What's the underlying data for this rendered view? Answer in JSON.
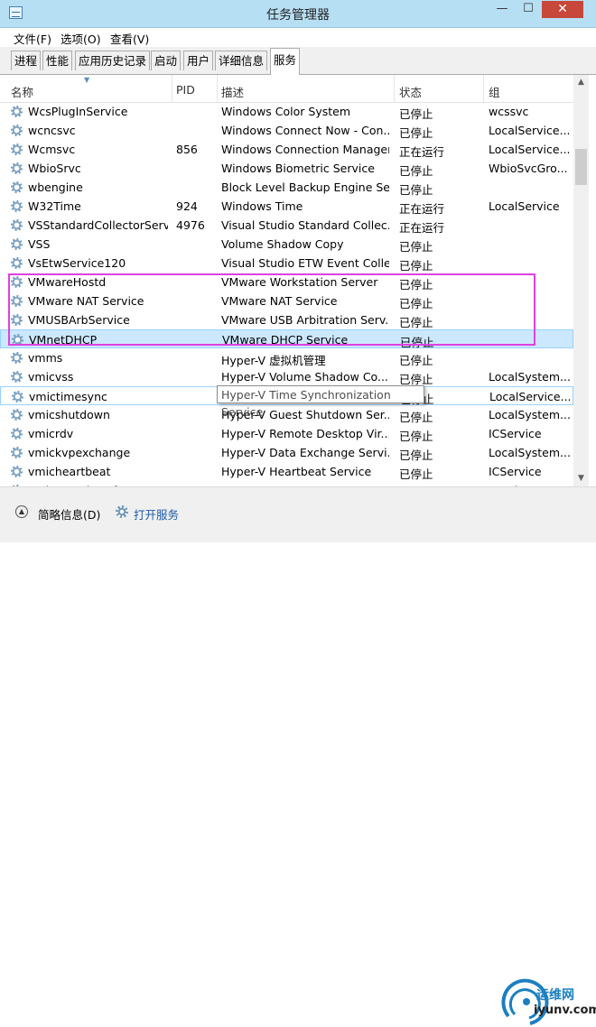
{
  "window": {
    "title": "任务管理器",
    "minimize": "—",
    "maximize": "☐",
    "close": "✕"
  },
  "menu": [
    "文件(F)",
    "选项(O)",
    "查看(V)"
  ],
  "tabs": [
    "进程",
    "性能",
    "应用历史记录",
    "启动",
    "用户",
    "详细信息",
    "服务"
  ],
  "active_tab": "服务",
  "columns": [
    "名称",
    "PID",
    "描述",
    "状态",
    "组"
  ],
  "rows": [
    {
      "name": "WcsPlugInService",
      "pid": "",
      "desc": "Windows Color System",
      "status": "已停止",
      "group": "wcssvc"
    },
    {
      "name": "wcncsvc",
      "pid": "",
      "desc": "Windows Connect Now - Con...",
      "status": "已停止",
      "group": "LocalService..."
    },
    {
      "name": "Wcmsvc",
      "pid": "856",
      "desc": "Windows Connection Manager",
      "status": "正在运行",
      "group": "LocalService..."
    },
    {
      "name": "WbioSrvc",
      "pid": "",
      "desc": "Windows Biometric Service",
      "status": "已停止",
      "group": "WbioSvcGro..."
    },
    {
      "name": "wbengine",
      "pid": "",
      "desc": "Block Level Backup Engine Se...",
      "status": "已停止",
      "group": ""
    },
    {
      "name": "W32Time",
      "pid": "924",
      "desc": "Windows Time",
      "status": "正在运行",
      "group": "LocalService"
    },
    {
      "name": "VSStandardCollectorServ...",
      "pid": "4976",
      "desc": "Visual Studio Standard Collec...",
      "status": "正在运行",
      "group": ""
    },
    {
      "name": "VSS",
      "pid": "",
      "desc": "Volume Shadow Copy",
      "status": "已停止",
      "group": ""
    },
    {
      "name": "VsEtwService120",
      "pid": "",
      "desc": "Visual Studio ETW Event Colle...",
      "status": "已停止",
      "group": ""
    },
    {
      "name": "VMwareHostd",
      "pid": "",
      "desc": "VMware Workstation Server",
      "status": "已停止",
      "group": ""
    },
    {
      "name": "VMware NAT Service",
      "pid": "",
      "desc": "VMware NAT Service",
      "status": "已停止",
      "group": ""
    },
    {
      "name": "VMUSBArbService",
      "pid": "",
      "desc": "VMware USB Arbitration Serv...",
      "status": "已停止",
      "group": ""
    },
    {
      "name": "VMnetDHCP",
      "pid": "",
      "desc": "VMware DHCP Service",
      "status": "已停止",
      "group": ""
    },
    {
      "name": "vmms",
      "pid": "",
      "desc": "Hyper-V 虚拟机管理",
      "status": "已停止",
      "group": ""
    },
    {
      "name": "vmicvss",
      "pid": "",
      "desc": "Hyper-V Volume Shadow Co...",
      "status": "已停止",
      "group": "LocalSystem..."
    },
    {
      "name": "vmictimesync",
      "pid": "",
      "desc": "Hyper-V Time Synchronizati...",
      "status": "已停止",
      "group": "LocalService..."
    },
    {
      "name": "vmicshutdown",
      "pid": "",
      "desc": "Hyper-V Guest Shutdown Ser...",
      "status": "已停止",
      "group": "LocalSystem..."
    },
    {
      "name": "vmicrdv",
      "pid": "",
      "desc": "Hyper-V Remote Desktop Vir...",
      "status": "已停止",
      "group": "ICService"
    },
    {
      "name": "vmickvpexchange",
      "pid": "",
      "desc": "Hyper-V Data Exchange Servi...",
      "status": "已停止",
      "group": "LocalSystem..."
    },
    {
      "name": "vmicheartbeat",
      "pid": "",
      "desc": "Hyper-V Heartbeat Service",
      "status": "已停止",
      "group": "ICService"
    },
    {
      "name": "vmicguestinterface",
      "pid": "",
      "desc": "Hyper-V 来宾服务接口",
      "status": "已停止",
      "group": "LocalSystem..."
    }
  ],
  "tooltip": "Hyper-V Time Synchronization Service",
  "footer": {
    "brief_label": "简略信息(D)",
    "open_services": "打开服务"
  },
  "watermark": {
    "line1": "运维网",
    "line2": "iyunv.com"
  },
  "colors": {
    "selected_row": "#cce8ff",
    "highlight_box": "#e040e0",
    "title_bar": "#b7dff4"
  }
}
